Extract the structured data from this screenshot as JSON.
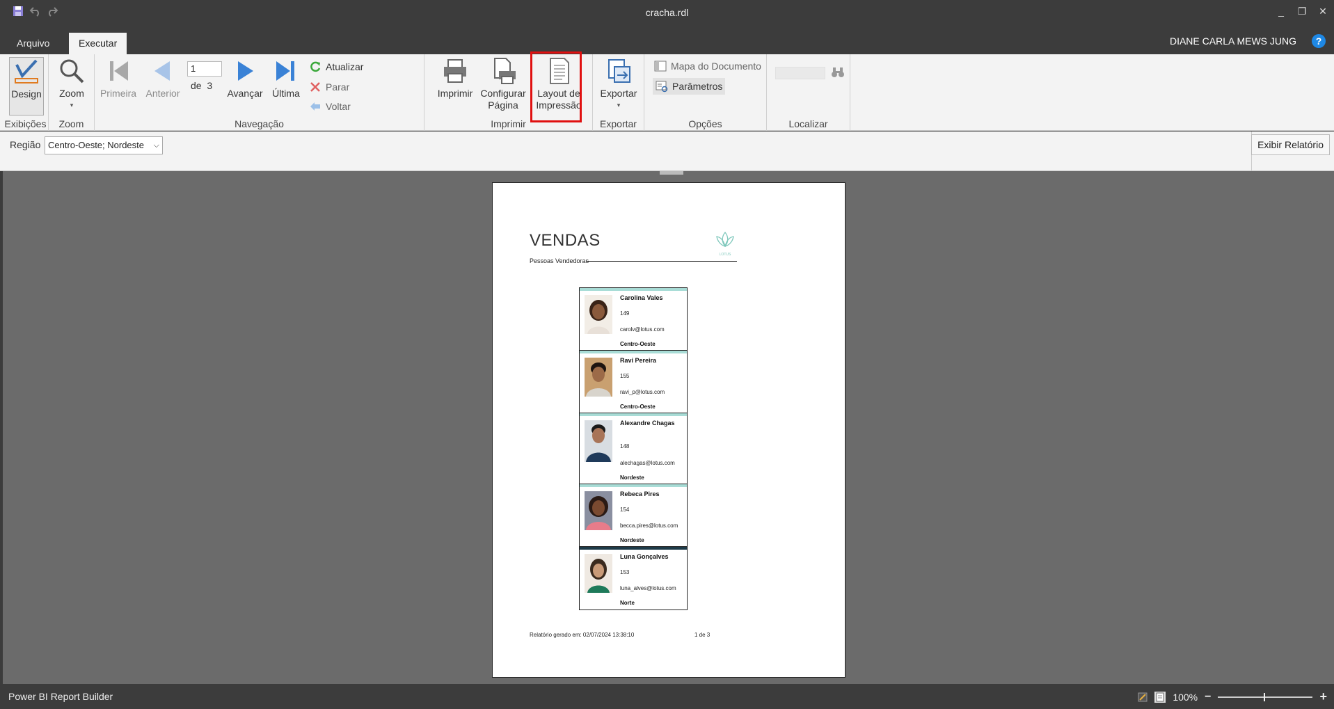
{
  "window": {
    "title": "cracha.rdl",
    "quick_access": [
      "save-icon",
      "undo-icon",
      "redo-icon"
    ]
  },
  "tabs": [
    {
      "label": "Arquivo",
      "active": false
    },
    {
      "label": "Executar",
      "active": true
    }
  ],
  "user": {
    "name": "DIANE CARLA MEWS JUNG",
    "help": "?"
  },
  "ribbon": {
    "views": {
      "design": "Design",
      "group": "Exibições"
    },
    "zoom": {
      "label": "Zoom",
      "group": "Zoom"
    },
    "navigation": {
      "first": "Primeira",
      "previous": "Anterior",
      "page_value": "1",
      "of_label": "de",
      "total_pages": "3",
      "next": "Avançar",
      "last": "Última",
      "refresh": "Atualizar",
      "stop": "Parar",
      "back": "Voltar",
      "group": "Navegação"
    },
    "print": {
      "print": "Imprimir",
      "page_setup_1": "Configurar",
      "page_setup_2": "Página",
      "print_layout_1": "Layout de",
      "print_layout_2": "Impressão",
      "group": "Imprimir"
    },
    "export": {
      "label": "Exportar",
      "group": "Exportar"
    },
    "options": {
      "document_map": "Mapa do Documento",
      "parameters": "Parâmetros",
      "group": "Opções"
    },
    "find": {
      "group": "Localizar",
      "input_value": ""
    }
  },
  "parameters": {
    "label": "Região",
    "selected": "Centro-Oeste; Nordeste",
    "view_button": "Exibir Relatório"
  },
  "report": {
    "title": "VENDAS",
    "subtitle": "Pessoas Vendedoras",
    "logo_text": "LOTUS",
    "badges": [
      {
        "name": "Carolina Vales",
        "id": "149",
        "email": "carolv@lotus.com",
        "region": "Centro-Oeste"
      },
      {
        "name": "Ravi Pereira",
        "id": "155",
        "email": "ravi_p@lotus.com",
        "region": "Centro-Oeste"
      },
      {
        "name": "Alexandre Chagas",
        "id": "148",
        "email": "alechagas@lotus.com",
        "region": "Nordeste"
      },
      {
        "name": "Rebeca Pires",
        "id": "154",
        "email": "becca.pires@lotus.com",
        "region": "Nordeste"
      },
      {
        "name": "Luna Gonçalves",
        "id": "153",
        "email": "luna_alves@lotus.com",
        "region": "Norte"
      }
    ],
    "footer": "Relatório gerado em: 02/07/2024 13:38:10",
    "page_indicator": "1 de 3"
  },
  "status": {
    "app_name": "Power BI Report Builder",
    "zoom": "100%"
  },
  "colors": {
    "accent_bar": "#a8dcd6",
    "highlight": "#e01010",
    "ribbon_bg": "#f3f3f3",
    "chrome_bg": "#3c3c3c"
  }
}
